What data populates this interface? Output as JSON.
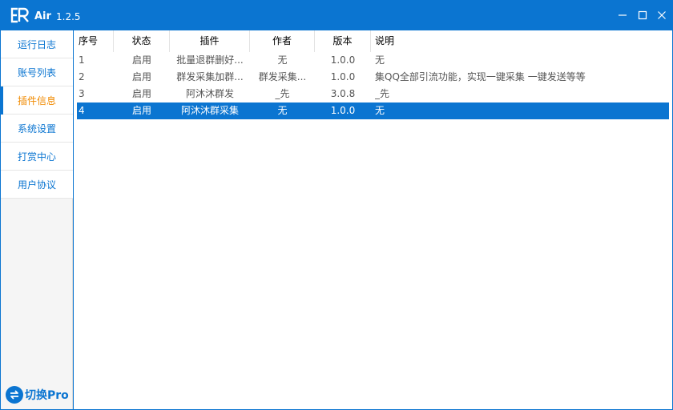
{
  "app": {
    "name": "Air",
    "version": "1.2.5"
  },
  "sidebar": {
    "items": [
      {
        "label": "运行日志",
        "active": false
      },
      {
        "label": "账号列表",
        "active": false
      },
      {
        "label": "插件信息",
        "active": true
      },
      {
        "label": "系统设置",
        "active": false
      },
      {
        "label": "打赏中心",
        "active": false
      },
      {
        "label": "用户协议",
        "active": false
      }
    ],
    "switch_label": "切换Pro"
  },
  "table": {
    "headers": [
      "序号",
      "状态",
      "插件",
      "作者",
      "版本",
      "说明"
    ],
    "rows": [
      {
        "index": "1",
        "status": "启用",
        "plugin": "批量退群删好...",
        "author": "无",
        "version": "1.0.0",
        "desc": "无"
      },
      {
        "index": "2",
        "status": "启用",
        "plugin": "群发采集加群...",
        "author": "群发采集...",
        "version": "1.0.0",
        "desc": "集QQ全部引流功能，实现一键采集 一键发送等等"
      },
      {
        "index": "3",
        "status": "启用",
        "plugin": "阿沐沐群发",
        "author": "_先",
        "version": "3.0.8",
        "desc": "_先"
      },
      {
        "index": "4",
        "status": "启用",
        "plugin": "阿沐沐群采集",
        "author": "无",
        "version": "1.0.0",
        "desc": "无"
      }
    ],
    "selected_row": 4
  },
  "colors": {
    "accent": "#0b75d1",
    "active_nav": "#f08a00"
  },
  "icons": {
    "minimize": "minimize-icon",
    "maximize": "maximize-icon",
    "close": "close-icon",
    "logo": "er-logo-icon",
    "switch": "switch-arrows-icon"
  }
}
